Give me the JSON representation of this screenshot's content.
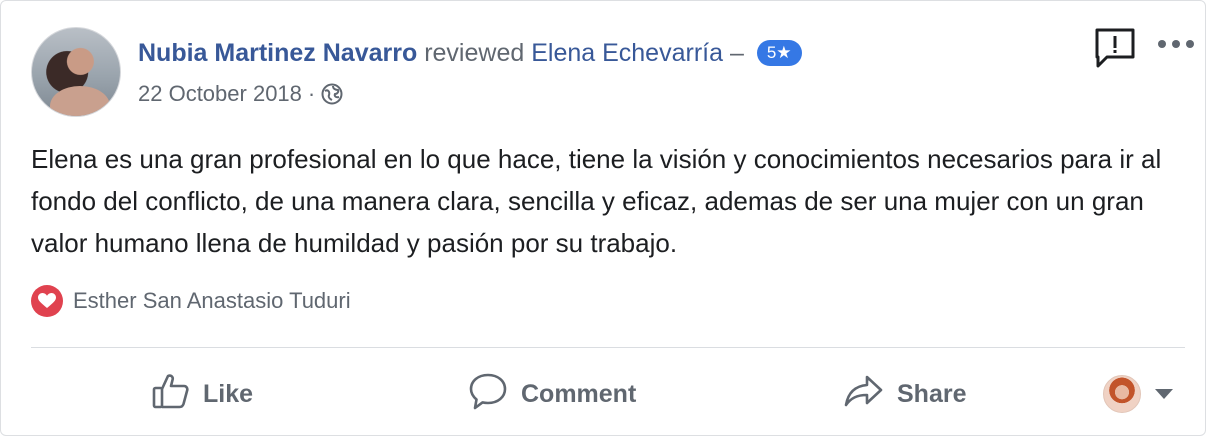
{
  "post": {
    "author": "Nubia Martinez Navarro",
    "verb": "reviewed",
    "page": "Elena Echevarría",
    "dash": "–",
    "rating": "5★",
    "date": "22 October 2018",
    "separator": "·",
    "privacy_icon": "globe-icon",
    "body": "Elena es una gran profesional en lo que hace, tiene la visión y conocimientos necesarios para ir al fondo del conflicto, de una manera clara, sencilla y eficaz, ademas de ser una mujer con un gran valor humano llena de humildad y pasión por su trabajo."
  },
  "reactions": {
    "icon": "heart-icon",
    "names": "Esther San Anastasio Tuduri"
  },
  "actions": {
    "like": "Like",
    "comment": "Comment",
    "share": "Share"
  },
  "colors": {
    "link": "#385898",
    "muted": "#606770",
    "badge": "#3578e5",
    "heart": "#e0424f"
  }
}
